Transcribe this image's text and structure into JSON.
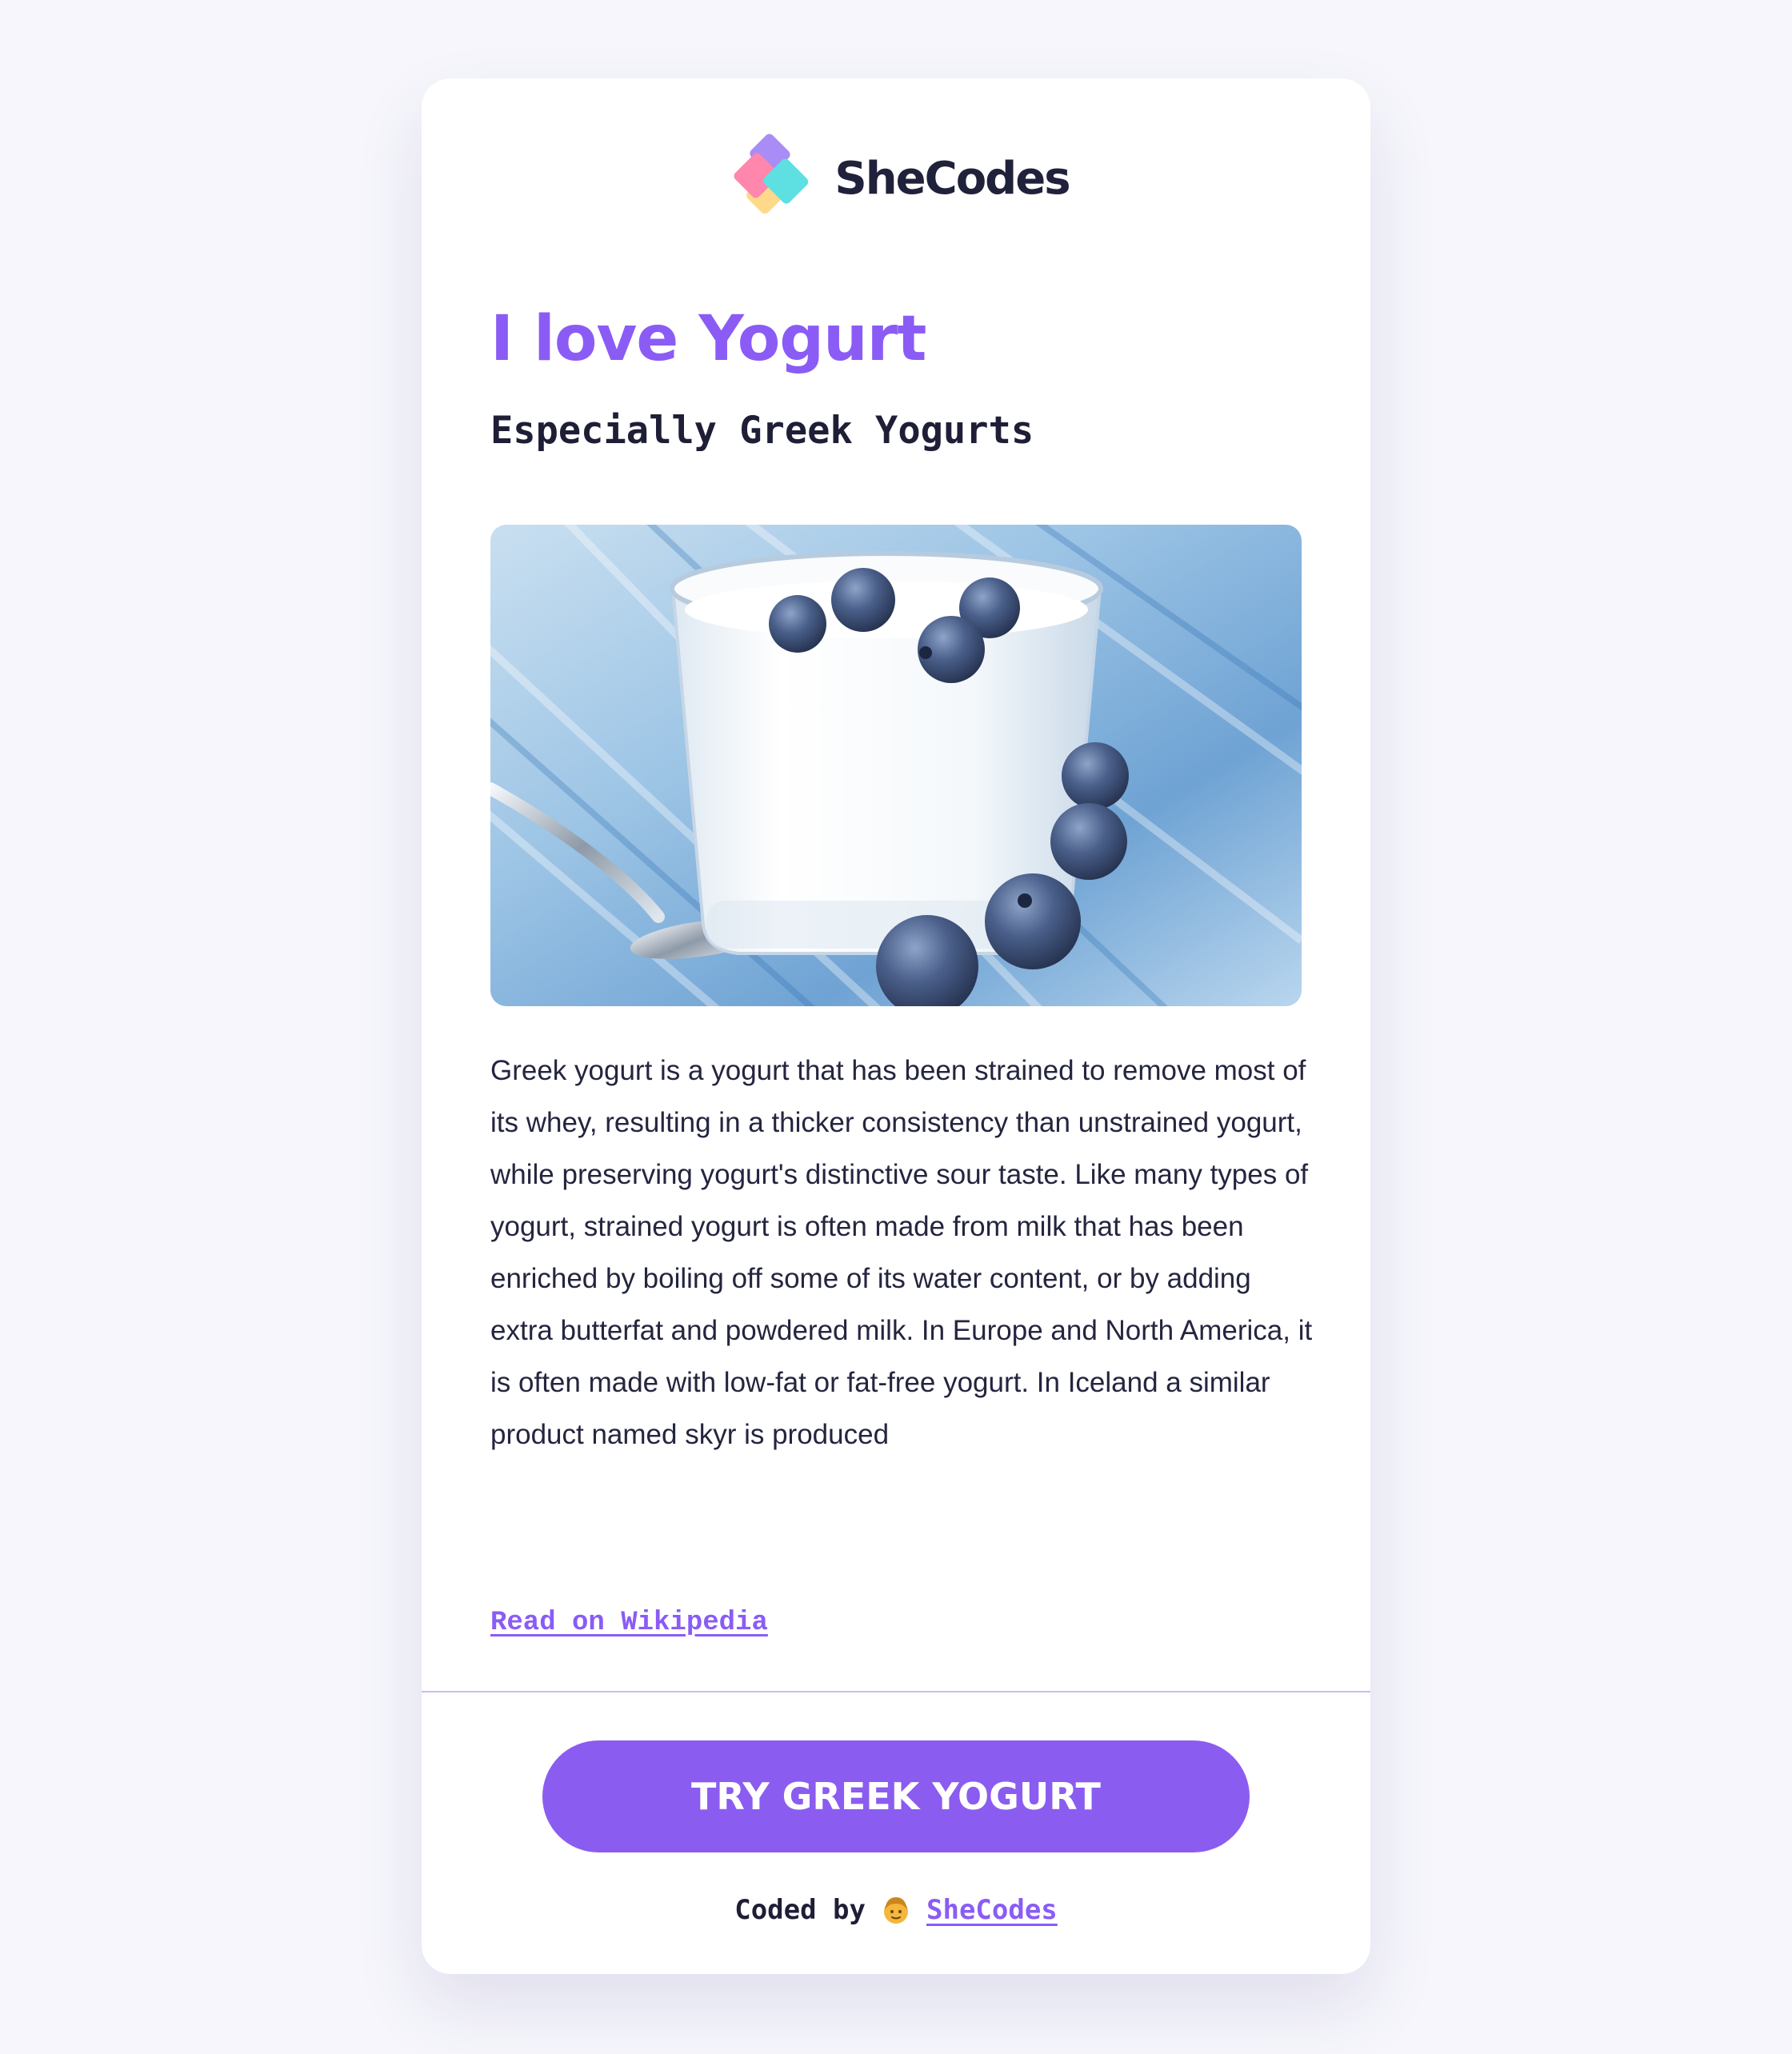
{
  "brand": {
    "name": "SheCodes",
    "logo_icon": "shecodes-logo-icon",
    "logo_colors": [
      "#a98cf6",
      "#ff86ad",
      "#5ee0e2",
      "#ffd98a"
    ]
  },
  "hero": {
    "title": "I love Yogurt",
    "subtitle": "Especially Greek Yogurts",
    "image_icon": "yogurt-blueberries-photo"
  },
  "body": {
    "description": "Greek yogurt is a yogurt that has been strained to remove most of its whey, resulting in a thicker consistency than unstrained yogurt, while preserving yogurt's distinctive sour taste. Like many types of yogurt, strained yogurt is often made from milk that has been enriched by boiling off some of its water content, or by adding extra butterfat and powdered milk. In Europe and North America, it is often made with low-fat or fat-free yogurt. In Iceland a similar product named skyr is produced",
    "link_label": "Read on Wikipedia"
  },
  "cta": {
    "label": "TRY GREEK YOGURT"
  },
  "footer": {
    "prefix": "Coded by",
    "emoji_icon": "woman-emoji-icon",
    "link_label": "SheCodes"
  },
  "colors": {
    "accent": "#8a5cf5",
    "button": "#8b5cf0",
    "text_dark": "#1e1f36",
    "page_bg": "#f6f6fc",
    "card_bg": "#ffffff",
    "divider": "#cbb9fb"
  }
}
